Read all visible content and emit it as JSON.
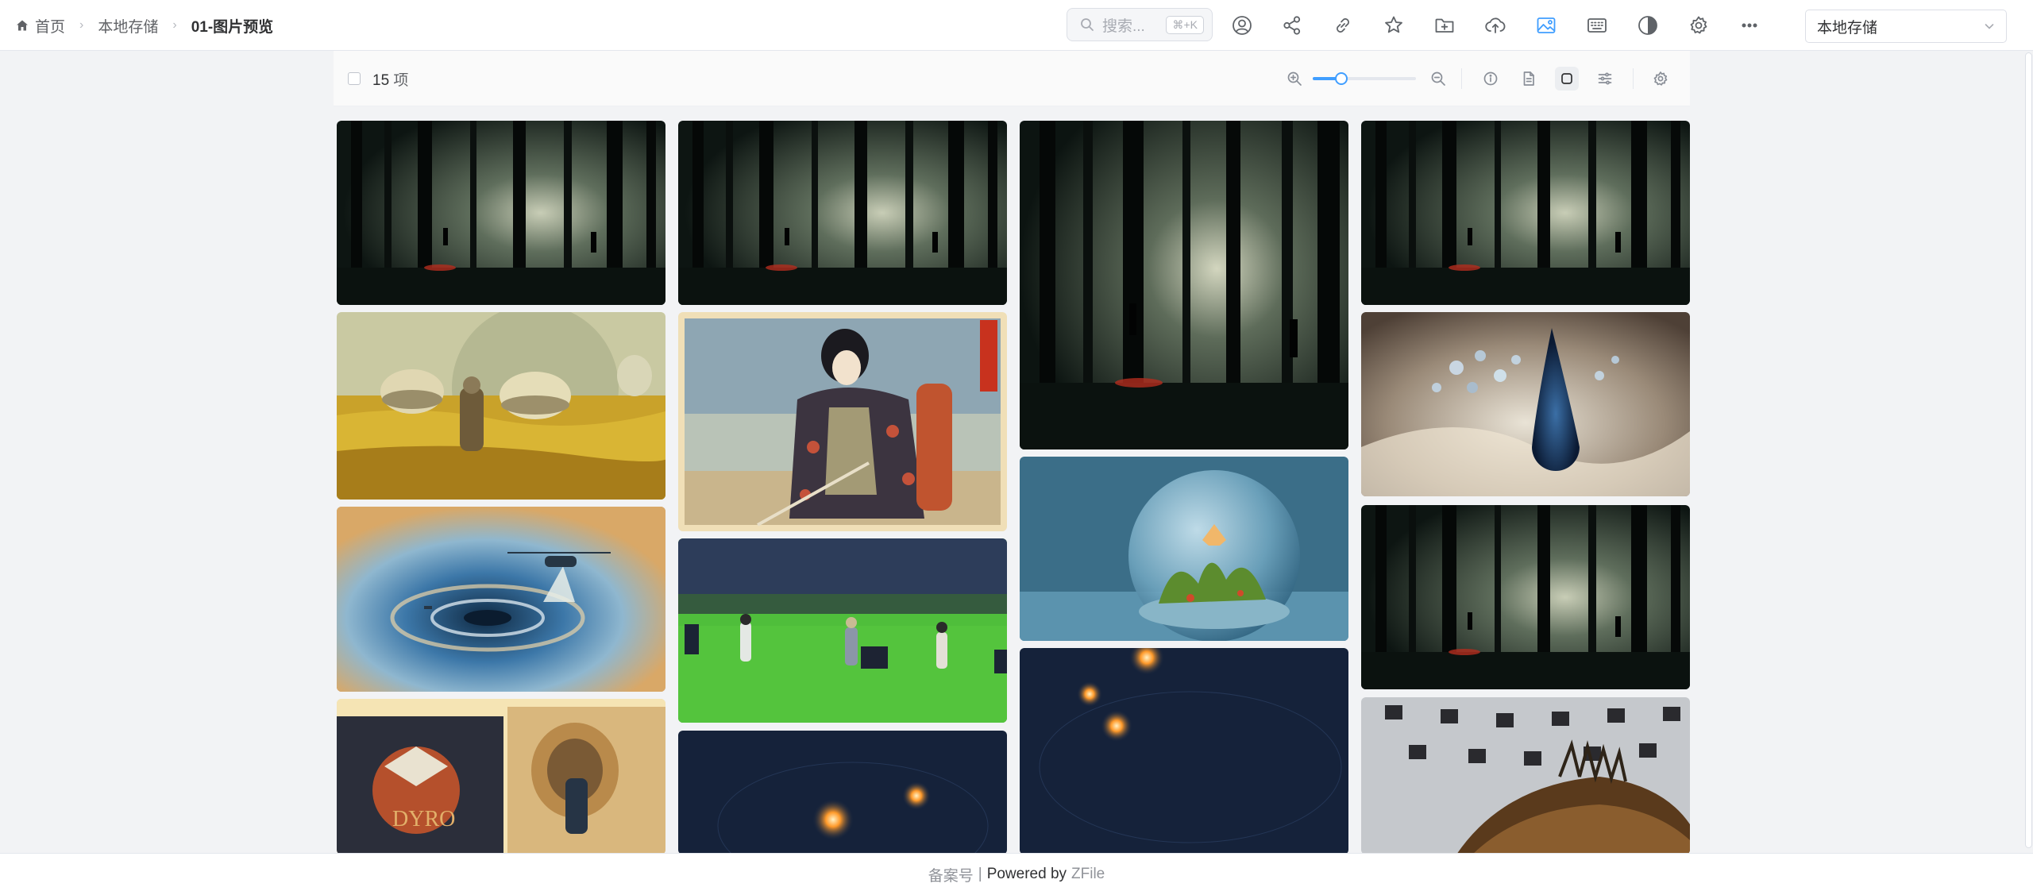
{
  "breadcrumb": {
    "home": "首页",
    "storage": "本地存储",
    "current": "01-图片预览"
  },
  "search": {
    "placeholder": "搜索...",
    "shortcut": "⌘+K"
  },
  "toolbar_icons": [
    "user-icon",
    "share-icon",
    "link-icon",
    "star-icon",
    "new-folder-icon",
    "upload-icon",
    "gallery-icon",
    "keyboard-icon",
    "theme-icon",
    "settings-icon",
    "more-icon"
  ],
  "storage_select": {
    "value": "本地存储"
  },
  "panel": {
    "count": "15",
    "count_unit": "项",
    "zoom_level": 0.28,
    "icons": [
      "zoom-in-icon",
      "zoom-out-icon",
      "info-icon",
      "file-icon",
      "gallery-mode-icon",
      "filter-icon",
      "panel-settings-icon"
    ]
  },
  "images": [
    {
      "name": "dark-forest",
      "scene": "forest"
    },
    {
      "name": "wheat-field-astronaut",
      "scene": "field"
    },
    {
      "name": "helicopter-whirlpool",
      "scene": "whirlpool"
    },
    {
      "name": "poster-collage",
      "scene": "poster"
    },
    {
      "name": "dark-forest",
      "scene": "forest"
    },
    {
      "name": "ukiyo-e-samurai",
      "scene": "ukiyo"
    },
    {
      "name": "band-in-meadow",
      "scene": "meadow"
    },
    {
      "name": "orange-planets",
      "scene": "space"
    },
    {
      "name": "dark-forest-tall",
      "scene": "forest"
    },
    {
      "name": "terrarium-globe",
      "scene": "globe"
    },
    {
      "name": "orange-planets",
      "scene": "space"
    },
    {
      "name": "dark-forest",
      "scene": "forest"
    },
    {
      "name": "cosmic-drop",
      "scene": "drop"
    },
    {
      "name": "dark-forest",
      "scene": "forest"
    },
    {
      "name": "fish-closeup",
      "scene": "fish"
    }
  ],
  "footer": {
    "beian": "备案号",
    "separator": "|",
    "powered": "Powered by",
    "brand": "ZFile"
  },
  "colors": {
    "accent": "#409eff",
    "background": "#f2f3f5"
  }
}
